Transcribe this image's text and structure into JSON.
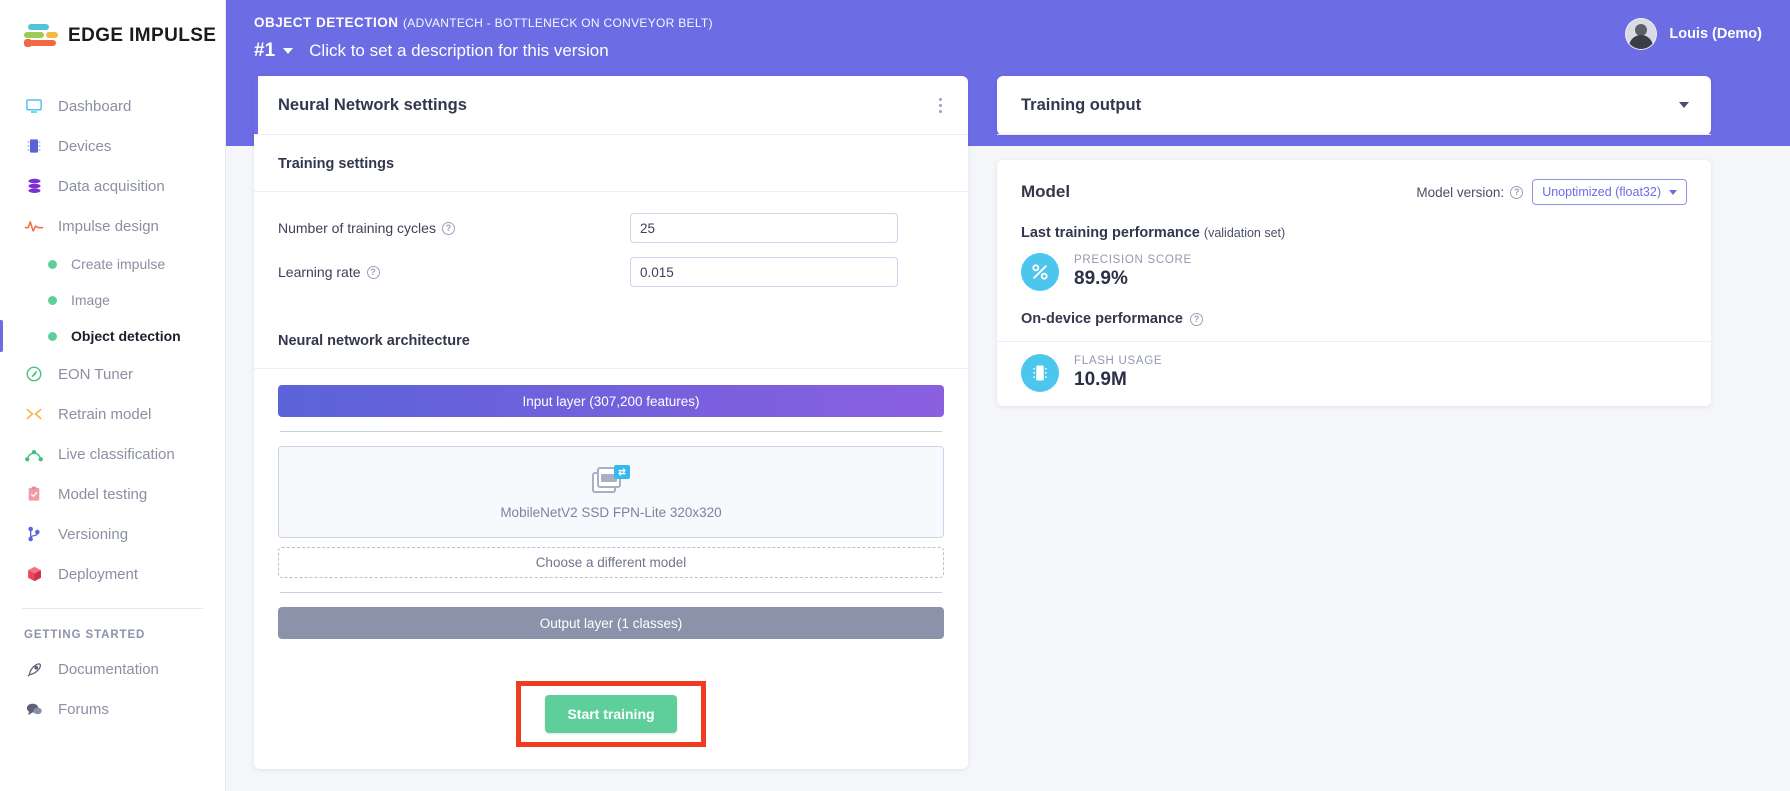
{
  "brand": {
    "name": "EDGE IMPULSE"
  },
  "sidebar": {
    "items": [
      {
        "label": "Dashboard",
        "icon": "monitor-icon"
      },
      {
        "label": "Devices",
        "icon": "chip-icon"
      },
      {
        "label": "Data acquisition",
        "icon": "database-icon"
      },
      {
        "label": "Impulse design",
        "icon": "waveform-icon"
      }
    ],
    "sub_items": [
      {
        "label": "Create impulse",
        "active": false
      },
      {
        "label": "Image",
        "active": false
      },
      {
        "label": "Object detection",
        "active": true
      }
    ],
    "items2": [
      {
        "label": "EON Tuner",
        "icon": "compass-icon"
      },
      {
        "label": "Retrain model",
        "icon": "shuffle-icon"
      },
      {
        "label": "Live classification",
        "icon": "graph-icon"
      },
      {
        "label": "Model testing",
        "icon": "clipboard-check-icon"
      },
      {
        "label": "Versioning",
        "icon": "branch-icon"
      },
      {
        "label": "Deployment",
        "icon": "box-icon"
      }
    ],
    "section_title": "GETTING STARTED",
    "items3": [
      {
        "label": "Documentation",
        "icon": "rocket-icon"
      },
      {
        "label": "Forums",
        "icon": "chat-icon"
      }
    ]
  },
  "header": {
    "breadcrumb_main": "OBJECT DETECTION",
    "breadcrumb_sub": "(ADVANTECH - BOTTLENECK ON CONVEYOR BELT)",
    "version": "#1",
    "version_description": "Click to set a description for this version",
    "user_name": "Louis (Demo)"
  },
  "nn_panel": {
    "title": "Neural Network settings",
    "menu_icon": "kebab-menu-icon",
    "training_settings_title": "Training settings",
    "fields": [
      {
        "label": "Number of training cycles",
        "value": "25",
        "help": "help-icon"
      },
      {
        "label": "Learning rate",
        "value": "0.015",
        "help": "help-icon"
      }
    ],
    "architecture_title": "Neural network architecture",
    "input_layer": "Input layer (307,200 features)",
    "model_name": "MobileNetV2 SSD FPN-Lite 320x320",
    "model_icon": "transfer-learning-image-icon",
    "choose_different": "Choose a different model",
    "output_layer": "Output layer (1 classes)",
    "start_training": "Start training"
  },
  "training_output": {
    "title": "Training output",
    "collapse_icon": "chevron-down-icon",
    "model_heading": "Model",
    "model_version_label": "Model version:",
    "model_version_value": "Unoptimized (float32)",
    "last_training_title": "Last training performance",
    "last_training_sub": "(validation set)",
    "precision_label": "PRECISION SCORE",
    "precision_value": "89.9%",
    "precision_icon": "percent-icon",
    "on_device_title": "On-device performance",
    "flash_label": "FLASH USAGE",
    "flash_value": "10.9M",
    "flash_icon": "chip-icon"
  },
  "colors": {
    "brand_purple": "#6c6ce5",
    "accent_green": "#5ecf9a",
    "highlight_red": "#ef3b20",
    "metric_cyan": "#4cc6ec"
  }
}
